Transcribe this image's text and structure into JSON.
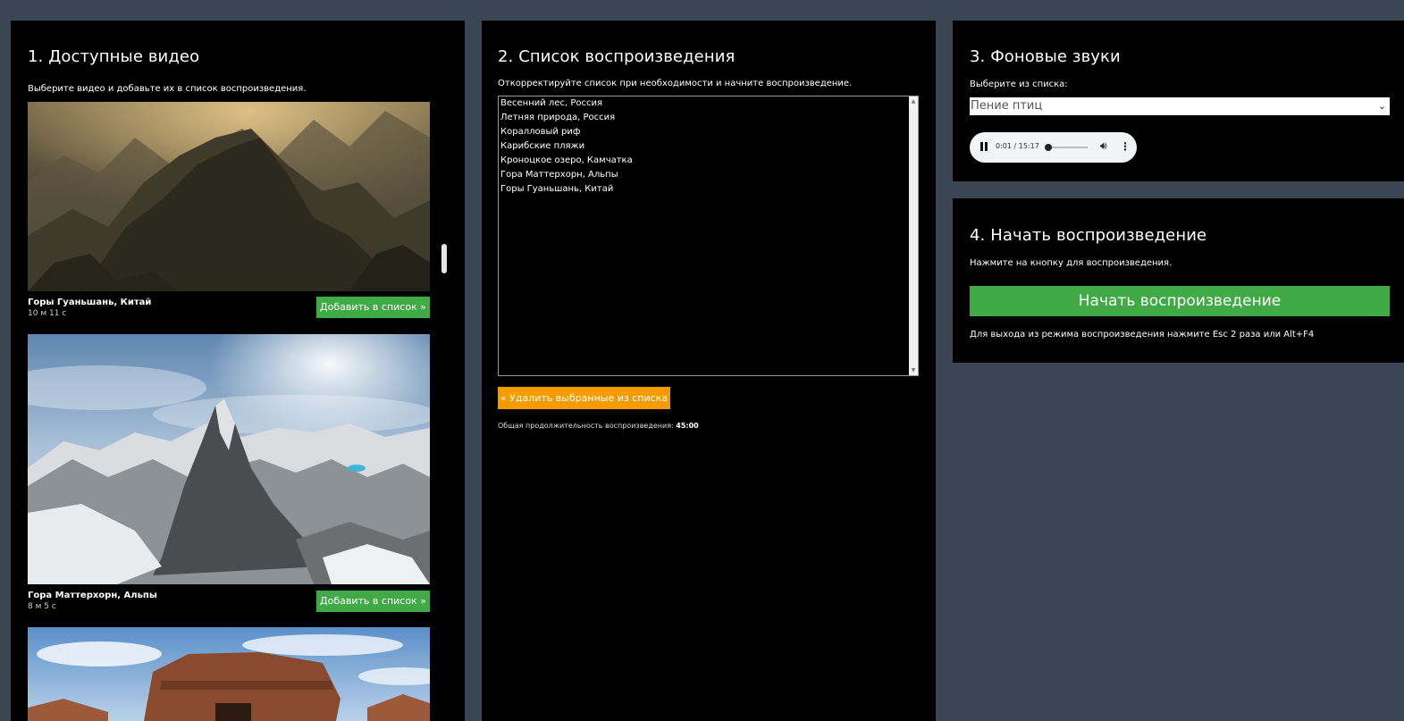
{
  "colors": {
    "background": "#3a4654",
    "panel": "#000000",
    "green": "#3faa46",
    "orange": "#f59b00"
  },
  "available": {
    "title": "1. Доступные видео",
    "subtitle": "Выберите видео и добавьте их в список воспроизведения.",
    "videos": [
      {
        "title": "Горы Гуаньшань, Китай",
        "duration": "10 м 11 с",
        "add_label": "Добавить в список »"
      },
      {
        "title": "Гора Маттерхорн, Альпы",
        "duration": "8 м 5 с",
        "add_label": "Добавить в список »"
      }
    ]
  },
  "playlist": {
    "title": "2. Список воспроизведения",
    "subtitle": "Откорректируйте список при необходимости и начните воспроизведение.",
    "items": [
      "Весенний лес, Россия",
      "Летняя природа, Россия",
      "Коралловый риф",
      "Карибские пляжи",
      "Кроноцкое озеро, Камчатка",
      "Гора Маттерхорн, Альпы",
      "Горы Гуаньшань, Китай"
    ],
    "remove_label": "« Удалить выбранные из списка",
    "total_label": "Общая продолжительность воспроизведения:",
    "total_value": "45:00"
  },
  "sounds": {
    "title": "3. Фоновые звуки",
    "subtitle": "Выберите из списка:",
    "selected": "Пение птиц",
    "audio": {
      "time": "0:01 / 15:17",
      "progress": 0.001
    }
  },
  "start": {
    "title": "4. Начать воспроизведение",
    "subtitle": "Нажмите на кнопку для воспроизведения.",
    "button_label": "Начать воспроизведение",
    "hint": "Для выхода из режима воспроизведения нажмите Esc 2 раза или Alt+F4"
  }
}
